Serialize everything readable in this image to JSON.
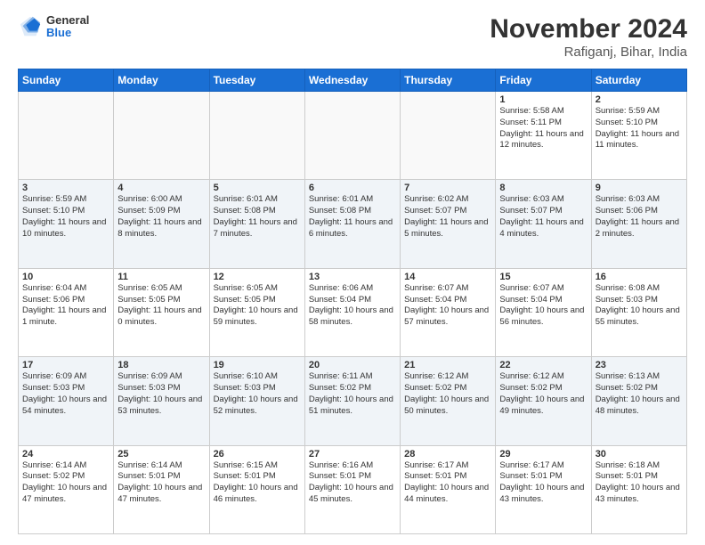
{
  "header": {
    "logo_line1": "General",
    "logo_line2": "Blue",
    "month": "November 2024",
    "location": "Rafiganj, Bihar, India"
  },
  "weekdays": [
    "Sunday",
    "Monday",
    "Tuesday",
    "Wednesday",
    "Thursday",
    "Friday",
    "Saturday"
  ],
  "weeks": [
    [
      {
        "day": "",
        "info": ""
      },
      {
        "day": "",
        "info": ""
      },
      {
        "day": "",
        "info": ""
      },
      {
        "day": "",
        "info": ""
      },
      {
        "day": "",
        "info": ""
      },
      {
        "day": "1",
        "info": "Sunrise: 5:58 AM\nSunset: 5:11 PM\nDaylight: 11 hours and 12 minutes."
      },
      {
        "day": "2",
        "info": "Sunrise: 5:59 AM\nSunset: 5:10 PM\nDaylight: 11 hours and 11 minutes."
      }
    ],
    [
      {
        "day": "3",
        "info": "Sunrise: 5:59 AM\nSunset: 5:10 PM\nDaylight: 11 hours and 10 minutes."
      },
      {
        "day": "4",
        "info": "Sunrise: 6:00 AM\nSunset: 5:09 PM\nDaylight: 11 hours and 8 minutes."
      },
      {
        "day": "5",
        "info": "Sunrise: 6:01 AM\nSunset: 5:08 PM\nDaylight: 11 hours and 7 minutes."
      },
      {
        "day": "6",
        "info": "Sunrise: 6:01 AM\nSunset: 5:08 PM\nDaylight: 11 hours and 6 minutes."
      },
      {
        "day": "7",
        "info": "Sunrise: 6:02 AM\nSunset: 5:07 PM\nDaylight: 11 hours and 5 minutes."
      },
      {
        "day": "8",
        "info": "Sunrise: 6:03 AM\nSunset: 5:07 PM\nDaylight: 11 hours and 4 minutes."
      },
      {
        "day": "9",
        "info": "Sunrise: 6:03 AM\nSunset: 5:06 PM\nDaylight: 11 hours and 2 minutes."
      }
    ],
    [
      {
        "day": "10",
        "info": "Sunrise: 6:04 AM\nSunset: 5:06 PM\nDaylight: 11 hours and 1 minute."
      },
      {
        "day": "11",
        "info": "Sunrise: 6:05 AM\nSunset: 5:05 PM\nDaylight: 11 hours and 0 minutes."
      },
      {
        "day": "12",
        "info": "Sunrise: 6:05 AM\nSunset: 5:05 PM\nDaylight: 10 hours and 59 minutes."
      },
      {
        "day": "13",
        "info": "Sunrise: 6:06 AM\nSunset: 5:04 PM\nDaylight: 10 hours and 58 minutes."
      },
      {
        "day": "14",
        "info": "Sunrise: 6:07 AM\nSunset: 5:04 PM\nDaylight: 10 hours and 57 minutes."
      },
      {
        "day": "15",
        "info": "Sunrise: 6:07 AM\nSunset: 5:04 PM\nDaylight: 10 hours and 56 minutes."
      },
      {
        "day": "16",
        "info": "Sunrise: 6:08 AM\nSunset: 5:03 PM\nDaylight: 10 hours and 55 minutes."
      }
    ],
    [
      {
        "day": "17",
        "info": "Sunrise: 6:09 AM\nSunset: 5:03 PM\nDaylight: 10 hours and 54 minutes."
      },
      {
        "day": "18",
        "info": "Sunrise: 6:09 AM\nSunset: 5:03 PM\nDaylight: 10 hours and 53 minutes."
      },
      {
        "day": "19",
        "info": "Sunrise: 6:10 AM\nSunset: 5:03 PM\nDaylight: 10 hours and 52 minutes."
      },
      {
        "day": "20",
        "info": "Sunrise: 6:11 AM\nSunset: 5:02 PM\nDaylight: 10 hours and 51 minutes."
      },
      {
        "day": "21",
        "info": "Sunrise: 6:12 AM\nSunset: 5:02 PM\nDaylight: 10 hours and 50 minutes."
      },
      {
        "day": "22",
        "info": "Sunrise: 6:12 AM\nSunset: 5:02 PM\nDaylight: 10 hours and 49 minutes."
      },
      {
        "day": "23",
        "info": "Sunrise: 6:13 AM\nSunset: 5:02 PM\nDaylight: 10 hours and 48 minutes."
      }
    ],
    [
      {
        "day": "24",
        "info": "Sunrise: 6:14 AM\nSunset: 5:02 PM\nDaylight: 10 hours and 47 minutes."
      },
      {
        "day": "25",
        "info": "Sunrise: 6:14 AM\nSunset: 5:01 PM\nDaylight: 10 hours and 47 minutes."
      },
      {
        "day": "26",
        "info": "Sunrise: 6:15 AM\nSunset: 5:01 PM\nDaylight: 10 hours and 46 minutes."
      },
      {
        "day": "27",
        "info": "Sunrise: 6:16 AM\nSunset: 5:01 PM\nDaylight: 10 hours and 45 minutes."
      },
      {
        "day": "28",
        "info": "Sunrise: 6:17 AM\nSunset: 5:01 PM\nDaylight: 10 hours and 44 minutes."
      },
      {
        "day": "29",
        "info": "Sunrise: 6:17 AM\nSunset: 5:01 PM\nDaylight: 10 hours and 43 minutes."
      },
      {
        "day": "30",
        "info": "Sunrise: 6:18 AM\nSunset: 5:01 PM\nDaylight: 10 hours and 43 minutes."
      }
    ]
  ]
}
